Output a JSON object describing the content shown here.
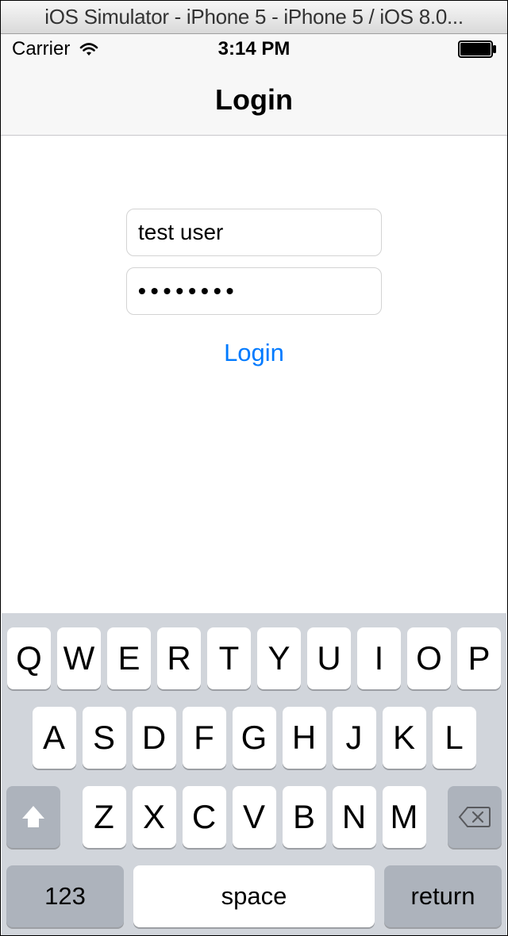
{
  "mac_titlebar": "iOS Simulator - iPhone 5 - iPhone 5 / iOS 8.0...",
  "status_bar": {
    "carrier": "Carrier",
    "time": "3:14 PM"
  },
  "nav": {
    "title": "Login"
  },
  "form": {
    "username_value": "test user",
    "password_value": "••••••••",
    "login_button": "Login"
  },
  "keyboard": {
    "row1": [
      "Q",
      "W",
      "E",
      "R",
      "T",
      "Y",
      "U",
      "I",
      "O",
      "P"
    ],
    "row2": [
      "A",
      "S",
      "D",
      "F",
      "G",
      "H",
      "J",
      "K",
      "L"
    ],
    "row3": [
      "Z",
      "X",
      "C",
      "V",
      "B",
      "N",
      "M"
    ],
    "numkey": "123",
    "space": "space",
    "return": "return"
  }
}
